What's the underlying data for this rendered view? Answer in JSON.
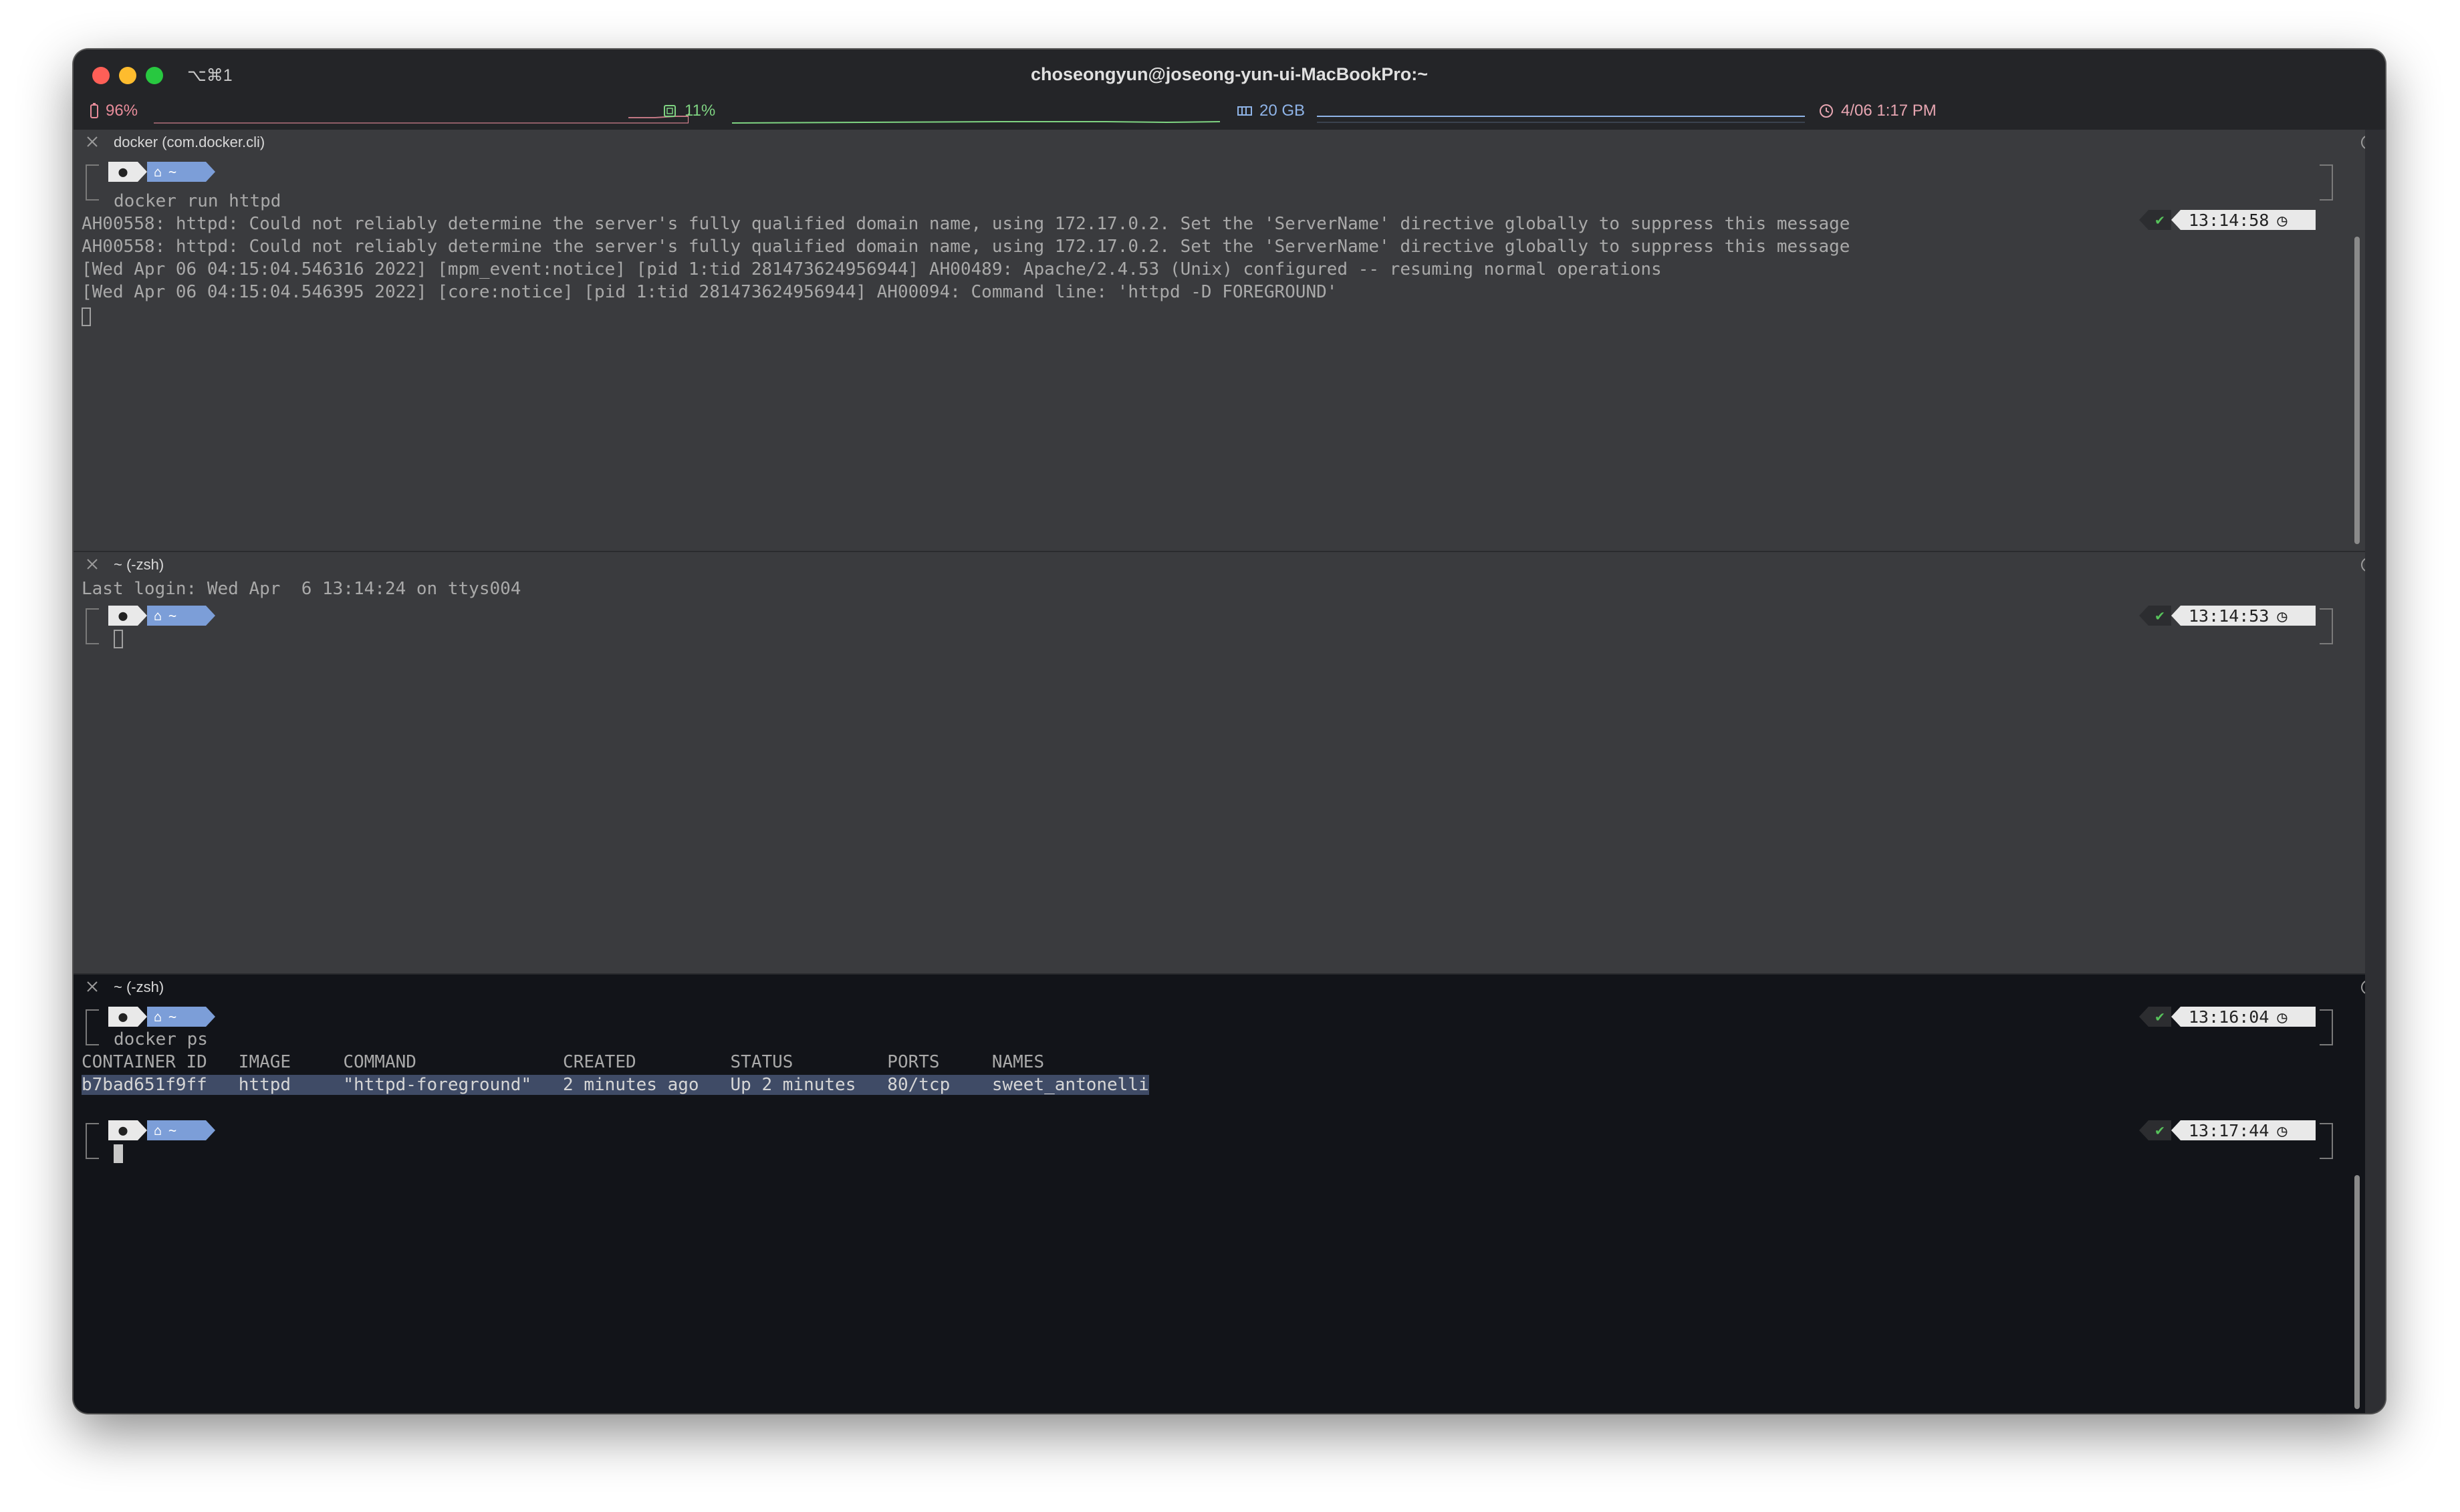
{
  "window": {
    "shortcut": "⌥⌘1",
    "title": "choseongyun@joseong-yun-ui-MacBookPro:~"
  },
  "status": {
    "battery": "96%",
    "cpu": "11%",
    "memory": "20 GB",
    "clock": "4/06 1:17 PM",
    "colors": {
      "battery": "#e88c9a",
      "cpu": "#7fd482",
      "memory": "#8fb4e8",
      "clock": "#e8a6b2"
    }
  },
  "panes": [
    {
      "title": "docker (com.docker.cli)",
      "prompt_dir": "~",
      "time": "13:14:58",
      "command": "docker run httpd",
      "output": [
        "AH00558: httpd: Could not reliably determine the server's fully qualified domain name, using 172.17.0.2. Set the 'ServerName' directive globally to suppress this message",
        "AH00558: httpd: Could not reliably determine the server's fully qualified domain name, using 172.17.0.2. Set the 'ServerName' directive globally to suppress this message",
        "[Wed Apr 06 04:15:04.546316 2022] [mpm_event:notice] [pid 1:tid 281473624956944] AH00489: Apache/2.4.53 (Unix) configured -- resuming normal operations",
        "[Wed Apr 06 04:15:04.546395 2022] [core:notice] [pid 1:tid 281473624956944] AH00094: Command line: 'httpd -D FOREGROUND'"
      ]
    },
    {
      "title": "~ (-zsh)",
      "last_login": "Last login: Wed Apr  6 13:14:24 on ttys004",
      "prompt_dir": "~",
      "time": "13:14:53"
    },
    {
      "title": "~ (-zsh)",
      "prompt_dir": "~",
      "time": "13:16:04",
      "command": "docker ps",
      "table": {
        "header": "CONTAINER ID   IMAGE     COMMAND              CREATED         STATUS         PORTS     NAMES",
        "row": "b7bad651f9ff   httpd     \"httpd-foreground\"   2 minutes ago   Up 2 minutes   80/tcp    sweet_antonelli"
      },
      "prompt2_dir": "~",
      "time2": "13:17:44"
    }
  ],
  "colors": {
    "pane_bg_inactive": "#3a3b3e",
    "pane_bg_active": "#121419",
    "prompt_accent": "#7c9ed8",
    "check": "#57c35b"
  }
}
